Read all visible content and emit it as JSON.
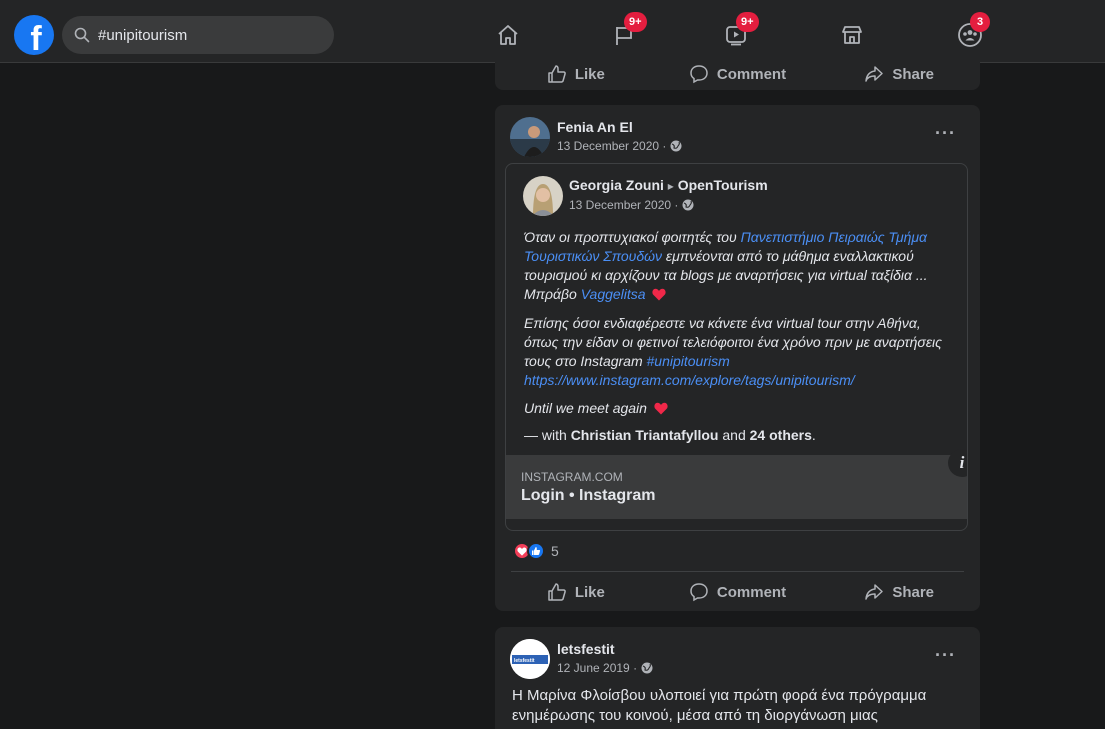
{
  "topbar": {
    "logo_letter": "f",
    "search": {
      "value": "#unipitourism"
    },
    "nav": [
      {
        "name": "home",
        "badge": ""
      },
      {
        "name": "pages",
        "badge": "9+"
      },
      {
        "name": "watch",
        "badge": "9+"
      },
      {
        "name": "marketplace",
        "badge": ""
      },
      {
        "name": "groups",
        "badge": "3"
      }
    ]
  },
  "actions": {
    "like": "Like",
    "comment": "Comment",
    "share": "Share"
  },
  "post1": {
    "author": "Fenia An El",
    "date": "13 December 2020 ·",
    "more": "···",
    "shared": {
      "author": "Georgia Zouni",
      "arrow": "▸",
      "group": "OpenTourism",
      "date": "13 December 2020 ·",
      "p1_a": "Όταν οι προπτυχιακοί φοιτητές του ",
      "p1_link1": "Πανεπιστήμιο Πειραιώς Τμήμα Τουριστικών Σπουδών",
      "p1_b": " εμπνέονται από το μάθημα εναλλακτικού τουρισμού κι αρχίζουν τα blogs με αναρτήσεις για virtual ταξίδια ... Μπράβο ",
      "p1_link2": "Vaggelitsa",
      "p2_a": "Επίσης όσοι ενδιαφέρεστε να κάνετε ένα virtual tour στην Αθήνα, όπως την είδαν οι φετινοί τελειόφοιτοι ένα χρόνο πριν με αναρτήσεις τους στο Instagram ",
      "p2_tag": "#unipitourism",
      "p2_url": "https://www.instagram.com/explore/tags/unipitourism/",
      "p3": "Until we meet again",
      "with_prefix": "— with ",
      "with_name": "Christian Triantafyllou",
      "with_and": " and ",
      "with_others": "24 others",
      "with_end": "."
    },
    "preview": {
      "domain": "INSTAGRAM.COM",
      "title": "Login • Instagram",
      "info": "i"
    },
    "reactions": {
      "count": "5"
    }
  },
  "post2": {
    "author": "letsfestit",
    "date": "12 June 2019 ·",
    "more": "···",
    "text": "Η Μαρίνα Φλοίσβου υλοποιεί για πρώτη φορά ένα πρόγραμμα ενημέρωσης του κοινού, μέσα από τη διοργάνωση μιας",
    "avatar_label": "letsfestit"
  },
  "colors": {
    "bg": "#18191a",
    "card": "#242526",
    "accent": "#1877f2",
    "link": "#4b8ff5",
    "badge": "#e41e3f"
  }
}
